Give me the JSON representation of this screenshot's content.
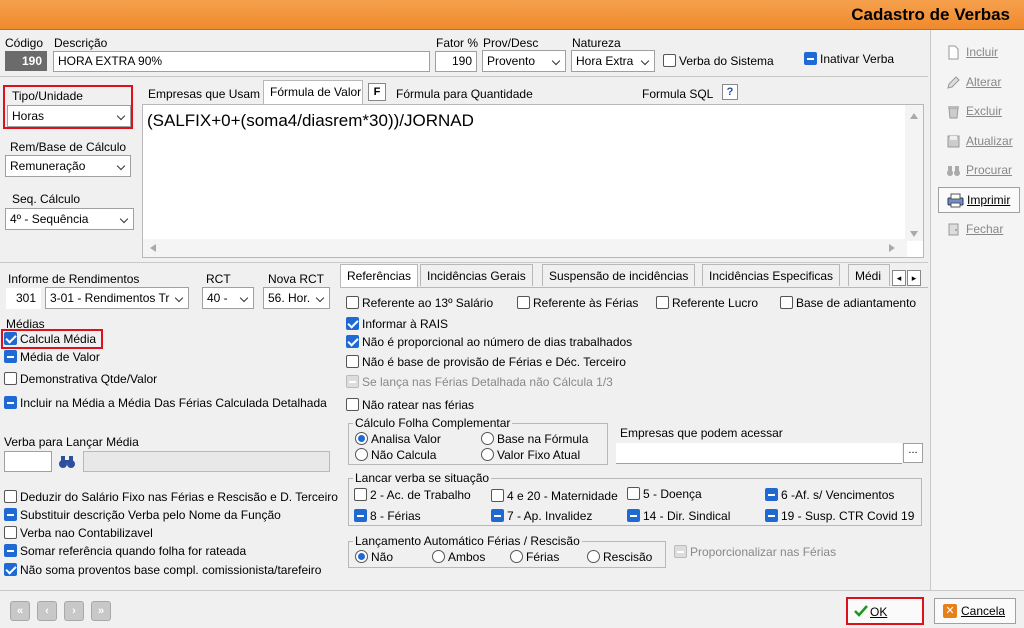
{
  "window": {
    "title": "Cadastro de Verbas"
  },
  "header": {
    "codigo_label": "Código",
    "codigo_value": "190",
    "descricao_label": "Descrição",
    "descricao_value": "HORA EXTRA 90%",
    "fator_label": "Fator %",
    "fator_value": "190",
    "prov_label": "Prov/Desc",
    "prov_value": "Provento",
    "natureza_label": "Natureza",
    "natureza_value": "Hora Extra",
    "verba_sistema_label": "Verba do Sistema",
    "inativar_label": "Inativar Verba"
  },
  "left_top": {
    "tipo_label": "Tipo/Unidade",
    "tipo_value": "Horas",
    "rem_label": "Rem/Base de Cálculo",
    "rem_value": "Remuneração",
    "seq_label": "Seq. Cálculo",
    "seq_value": "4º - Sequência"
  },
  "formula_tabs": {
    "empresas": "Empresas que Usam",
    "formula_valor": "Fórmula de Valor",
    "f_btn": "F",
    "formula_qtd": "Fórmula para Quantidade",
    "formula_sql": "Formula SQL",
    "help_btn": "?",
    "formula_text": "(SALFIX+0+(soma4/diasrem*30))/JORNAD"
  },
  "informe": {
    "label": "Informe de Rendimentos",
    "code": "301",
    "value": "3-01 - Rendimentos Tr",
    "rct_label": "RCT",
    "rct_value": "40 -",
    "nova_rct_label": "Nova RCT",
    "nova_rct_value": "56. Hor."
  },
  "medias": {
    "label": "Médias",
    "calcula_media": "Calcula Média",
    "media_valor": "Média de Valor",
    "demonstrativa": "Demonstrativa Qtde/Valor",
    "incluir": "Incluir na Média a Média Das Férias Calculada Detalhada",
    "verba_lancar_label": "Verba para Lançar Média"
  },
  "left_bottom": {
    "deduzir": "Deduzir do Salário Fixo nas  Férias e Rescisão e D. Terceiro",
    "substituir": "Substituir descrição Verba pelo Nome da Função",
    "nao_contabil": "Verba nao Contabilizavel",
    "somar": "Somar referência quando folha for rateada",
    "nao_soma": "Não soma proventos base compl. comissionista/tarefeiro"
  },
  "ref_tabs": [
    "Referências",
    "Incidências Gerais",
    "Suspensão de incidências",
    "Incidências Especificas",
    "Médi"
  ],
  "referencias": {
    "ref_13": "Referente ao 13º Salário",
    "ref_ferias": "Referente às Férias",
    "ref_lucro": "Referente Lucro",
    "base_adiant": "Base de adiantamento",
    "informar_rais": "Informar à RAIS",
    "nao_proporcional": "Não é proporcional ao número de dias trabalhados",
    "nao_base_provisao": "Não é base de provisão de Férias e Déc. Terceiro",
    "se_lanca": "Se lança nas Férias Detalhada não Cálcula 1/3",
    "nao_ratear": "Não ratear nas férias",
    "calc_folha_label": "Cálculo Folha Complementar",
    "analisa_valor": "Analisa Valor",
    "base_formula": "Base na Fórmula",
    "nao_calcula": "Não Calcula",
    "valor_fixo": "Valor Fixo Atual",
    "empresas_acessar": "Empresas que podem acessar",
    "ellipsis": "...",
    "lancar_label": "Lancar verba se situação",
    "s2": "2 - Ac. de Trabalho",
    "s4": "4 e 20 - Maternidade",
    "s5": "5 - Doença",
    "s6": "6 -Af. s/ Vencimentos",
    "s8": "8 - Férias",
    "s7": "7 - Ap. Invalidez",
    "s14": "14  - Dir. Sindical",
    "s19": "19 - Susp. CTR Covid 19",
    "lanc_auto_label": "Lançamento Automático Férias / Rescisão",
    "r_nao": "Não",
    "r_ambos": "Ambos",
    "r_ferias": "Férias",
    "r_rescisao": "Rescisão",
    "proporcionalizar": "Proporcionalizar nas Férias"
  },
  "sidebar": [
    "Incluir",
    "Alterar",
    "Excluir",
    "Atualizar",
    "Procurar",
    "Imprimir",
    "Fechar"
  ],
  "footer": {
    "ok": "OK",
    "cancel": "Cancela"
  }
}
